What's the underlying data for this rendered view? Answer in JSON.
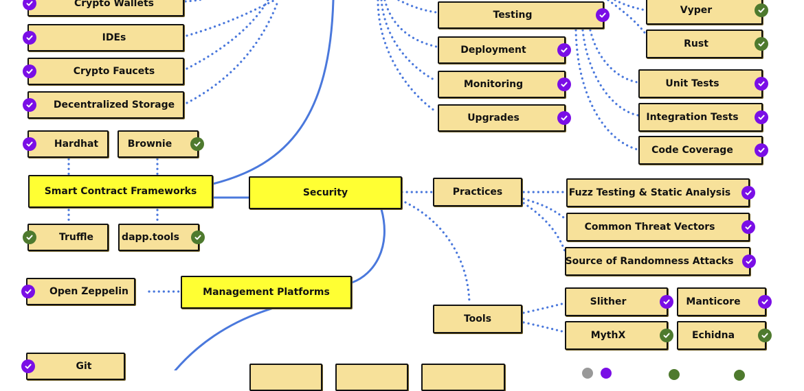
{
  "colors": {
    "node_fill": "#f7e19a",
    "main_fill": "#ffff33",
    "link": "#4a78dc",
    "done": "#7a0ee6",
    "alternative": "#4e7a2e",
    "neutral": "#999999"
  },
  "nodes": [
    {
      "id": "crypto-wallets",
      "label": "Crypto Wallets",
      "badge": "done",
      "badge_side": "left"
    },
    {
      "id": "ides",
      "label": "IDEs",
      "badge": "done",
      "badge_side": "left"
    },
    {
      "id": "crypto-faucets",
      "label": "Crypto Faucets",
      "badge": "done",
      "badge_side": "left"
    },
    {
      "id": "decentralized-storage",
      "label": "Decentralized Storage",
      "badge": "done",
      "badge_side": "left"
    },
    {
      "id": "hardhat",
      "label": "Hardhat",
      "badge": "done",
      "badge_side": "left"
    },
    {
      "id": "brownie",
      "label": "Brownie",
      "badge": "alternative",
      "badge_side": "right"
    },
    {
      "id": "smart-contract-frameworks",
      "label": "Smart Contract Frameworks",
      "main": true
    },
    {
      "id": "truffle",
      "label": "Truffle",
      "badge": "alternative",
      "badge_side": "left"
    },
    {
      "id": "dapp-tools",
      "label": "dapp.tools",
      "badge": "alternative",
      "badge_side": "right"
    },
    {
      "id": "security",
      "label": "Security",
      "main": true
    },
    {
      "id": "open-zeppelin",
      "label": "Open Zeppelin",
      "badge": "done",
      "badge_side": "left"
    },
    {
      "id": "management-platforms",
      "label": "Management Platforms",
      "main": true
    },
    {
      "id": "git",
      "label": "Git",
      "badge": "done",
      "badge_side": "left"
    },
    {
      "id": "testing",
      "label": "Testing",
      "badge": "done",
      "badge_side": "right"
    },
    {
      "id": "deployment",
      "label": "Deployment",
      "badge": "done",
      "badge_side": "right"
    },
    {
      "id": "monitoring",
      "label": "Monitoring",
      "badge": "done",
      "badge_side": "right"
    },
    {
      "id": "upgrades",
      "label": "Upgrades",
      "badge": "done",
      "badge_side": "right"
    },
    {
      "id": "vyper",
      "label": "Vyper",
      "badge": "alternative",
      "badge_side": "right"
    },
    {
      "id": "rust",
      "label": "Rust",
      "badge": "alternative",
      "badge_side": "right"
    },
    {
      "id": "unit-tests",
      "label": "Unit Tests",
      "badge": "done",
      "badge_side": "right"
    },
    {
      "id": "integration-tests",
      "label": "Integration Tests",
      "badge": "done",
      "badge_side": "right"
    },
    {
      "id": "code-coverage",
      "label": "Code Coverage",
      "badge": "done",
      "badge_side": "right"
    },
    {
      "id": "practices",
      "label": "Practices"
    },
    {
      "id": "fuzz-testing",
      "label": "Fuzz Testing & Static Analysis",
      "badge": "done",
      "badge_side": "right"
    },
    {
      "id": "common-threat-vectors",
      "label": "Common Threat Vectors",
      "badge": "done",
      "badge_side": "right"
    },
    {
      "id": "source-of-randomness",
      "label": "Source of Randomness Attacks",
      "badge": "done",
      "badge_side": "right"
    },
    {
      "id": "tools",
      "label": "Tools"
    },
    {
      "id": "slither",
      "label": "Slither",
      "badge": "done",
      "badge_side": "right"
    },
    {
      "id": "manticore",
      "label": "Manticore",
      "badge": "done",
      "badge_side": "right"
    },
    {
      "id": "mythx",
      "label": "MythX",
      "badge": "alternative",
      "badge_side": "right"
    },
    {
      "id": "echidna",
      "label": "Echidna",
      "badge": "alternative",
      "badge_side": "right"
    },
    {
      "id": "bottom-1",
      "label": ""
    },
    {
      "id": "bottom-2",
      "label": ""
    },
    {
      "id": "bottom-3",
      "label": ""
    }
  ],
  "legend": [
    "neutral",
    "done",
    "alternative",
    "alternative"
  ]
}
